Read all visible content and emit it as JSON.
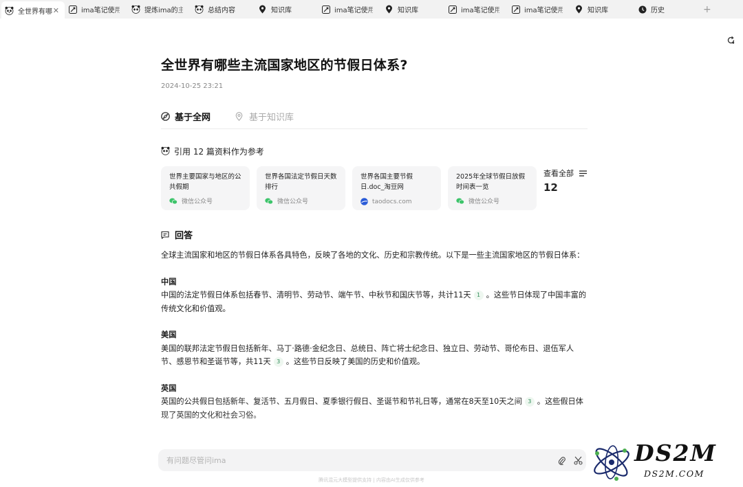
{
  "tabs": [
    {
      "label": "全世界有哪",
      "icon": "panda-icon",
      "active": true
    },
    {
      "label": "ima笔记使用",
      "icon": "ima-note-icon"
    },
    {
      "label": "提炼ima的主",
      "icon": "panda-icon"
    },
    {
      "label": "总结内容",
      "icon": "panda-icon"
    },
    {
      "label": "知识库",
      "icon": "knowledge-pin-icon"
    },
    {
      "label": "ima笔记使用",
      "icon": "ima-note-icon"
    },
    {
      "label": "知识库",
      "icon": "knowledge-pin-icon"
    },
    {
      "label": "ima笔记使用",
      "icon": "ima-note-icon"
    },
    {
      "label": "ima笔记使用",
      "icon": "ima-note-icon"
    },
    {
      "label": "知识库",
      "icon": "knowledge-pin-icon"
    },
    {
      "label": "历史",
      "icon": "history-clock-icon"
    }
  ],
  "tab_close": "✕",
  "new_tab": "+",
  "question": {
    "title": "全世界有哪些主流国家地区的节假日体系?",
    "date": "2024-10-25 23:21"
  },
  "scope": {
    "web_label": "基于全网",
    "kb_label": "基于知识库"
  },
  "references": {
    "heading": "引用 12 篇资料作为参考",
    "view_all_label": "查看全部",
    "count": "12",
    "cards": [
      {
        "title": "世界主要国家与地区的公共假期",
        "source": "微信公众号",
        "source_icon": "wechat-icon"
      },
      {
        "title": "世界各国法定节假日天数排行",
        "source": "微信公众号",
        "source_icon": "wechat-icon"
      },
      {
        "title": "世界各国主要节假日.doc_淘豆网",
        "source": "taodocs.com",
        "source_icon": "taodocs-icon"
      },
      {
        "title": "2025年全球节假日放假时间表一览",
        "source": "微信公众号",
        "source_icon": "wechat-icon"
      }
    ]
  },
  "answer": {
    "heading": "回答",
    "intro": "全球主流国家和地区的节假日体系各具特色，反映了各地的文化、历史和宗教传统。以下是一些主流国家地区的节假日体系：",
    "sections": [
      {
        "country": "中国",
        "text_before": "中国的法定节假日体系包括春节、清明节、劳动节、端午节、中秋节和国庆节等，共计11天",
        "cite": "1",
        "text_after": "。这些节日体现了中国丰富的传统文化和价值观。"
      },
      {
        "country": "美国",
        "text_before": "美国的联邦法定节假日包括新年、马丁·路德·金纪念日、总统日、阵亡将士纪念日、独立日、劳动节、哥伦布日、退伍军人节、感恩节和圣诞节等，共11天",
        "cite": "3",
        "text_after": "。这些节日反映了美国的历史和价值观。"
      },
      {
        "country": "英国",
        "text_before": "英国的公共假日包括新年、复活节、五月假日、夏季银行假日、圣诞节和节礼日等，通常在8天至10天之间",
        "cite": "3",
        "text_after": "。这些假日体现了英国的文化和社会习俗。"
      }
    ]
  },
  "ask": {
    "placeholder": "有问题尽管问ima"
  },
  "disclaimer": "腾讯混元大模型提供支持 | 内容由AI生成仅供参考",
  "watermark": {
    "text": "DS2M",
    "url": "DS2M.COM"
  },
  "colors": {
    "accent_green": "#2e8b57",
    "wechat_green": "#3cc46a",
    "taodocs_blue": "#2a5bd7"
  }
}
